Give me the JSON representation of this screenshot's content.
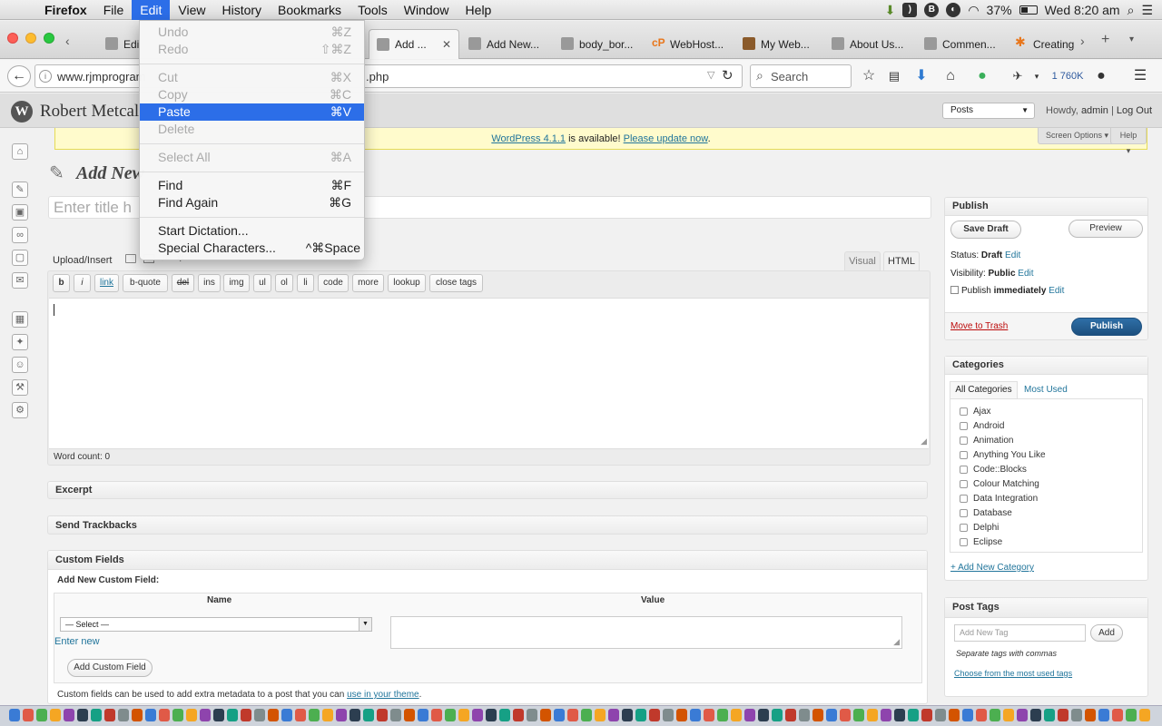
{
  "menubar": {
    "apple": "",
    "app": "Firefox",
    "items": [
      "File",
      "Edit",
      "View",
      "History",
      "Bookmarks",
      "Tools",
      "Window",
      "Help"
    ],
    "battery": "37%",
    "clock": "Wed 8:20 am"
  },
  "tabs": [
    {
      "label": "Edi"
    },
    {
      "label": "Add ..."
    },
    {
      "label": "Add New..."
    },
    {
      "label": "body_bor..."
    },
    {
      "label": "WebHost..."
    },
    {
      "label": "My Web..."
    },
    {
      "label": "About Us..."
    },
    {
      "label": "Commen..."
    },
    {
      "label": "Creating"
    }
  ],
  "cpanel_logo": "cP",
  "nav": {
    "url": "www.rjmprogram",
    "url_tail": ".php",
    "search_placeholder": "Search",
    "download_size": "1 760K"
  },
  "wp": {
    "site_title": "Robert Metcal",
    "posts_select": "Posts",
    "howdy": "Howdy,",
    "user": "admin",
    "logout": "Log Out",
    "notice_link": "WordPress 4.1.1",
    "notice_text": " is available! ",
    "notice_update": "Please update now",
    "notice_end": ".",
    "screen_options": "Screen Options",
    "help": "Help",
    "page_title": "Add New",
    "title_placeholder": "Enter title h",
    "upload_insert": "Upload/Insert",
    "tab_visual": "Visual",
    "tab_html": "HTML",
    "quicktags": [
      "b",
      "i",
      "link",
      "b-quote",
      "del",
      "ins",
      "img",
      "ul",
      "ol",
      "li",
      "code",
      "more",
      "lookup",
      "close tags"
    ],
    "word_count": "Word count: 0",
    "excerpt": "Excerpt",
    "trackbacks": "Send Trackbacks",
    "custom_fields": "Custom Fields",
    "add_new_cf": "Add New Custom Field:",
    "col_name": "Name",
    "col_value": "Value",
    "select_default": "— Select —",
    "enter_new": "Enter new",
    "add_cf_btn": "Add Custom Field",
    "cf_help": "Custom fields can be used to add extra metadata to a post that you can ",
    "cf_help_link": "use in your theme",
    "cf_help_end": ".",
    "publish": {
      "title": "Publish",
      "save_draft": "Save Draft",
      "preview": "Preview",
      "status_label": "Status:",
      "status": "Draft",
      "visibility_label": "Visibility:",
      "visibility": "Public",
      "publish_label": "Publish",
      "publish_when": "immediately",
      "edit": "Edit",
      "trash": "Move to Trash",
      "publish_btn": "Publish"
    },
    "categories": {
      "title": "Categories",
      "tab_all": "All Categories",
      "tab_used": "Most Used",
      "items": [
        "Ajax",
        "Android",
        "Animation",
        "Anything You Like",
        "Code::Blocks",
        "Colour Matching",
        "Data Integration",
        "Database",
        "Delphi",
        "Eclipse"
      ],
      "add": "+ Add New Category"
    },
    "tags": {
      "title": "Post Tags",
      "placeholder": "Add New Tag",
      "add": "Add",
      "hint": "Separate tags with commas",
      "choose": "Choose from the most used tags"
    }
  },
  "editmenu": [
    {
      "label": "Undo",
      "shortcut": "⌘Z",
      "disabled": true
    },
    {
      "label": "Redo",
      "shortcut": "⇧⌘Z",
      "disabled": true
    },
    {
      "label": "Cut",
      "shortcut": "⌘X",
      "disabled": true
    },
    {
      "label": "Copy",
      "shortcut": "⌘C",
      "disabled": true
    },
    {
      "label": "Paste",
      "shortcut": "⌘V",
      "highlight": true
    },
    {
      "label": "Delete",
      "shortcut": "",
      "disabled": true
    },
    {
      "label": "Select All",
      "shortcut": "⌘A",
      "disabled": true
    },
    {
      "label": "Find",
      "shortcut": "⌘F"
    },
    {
      "label": "Find Again",
      "shortcut": "⌘G"
    },
    {
      "label": "Start Dictation...",
      "shortcut": ""
    },
    {
      "label": "Special Characters...",
      "shortcut": "^⌘Space"
    }
  ]
}
